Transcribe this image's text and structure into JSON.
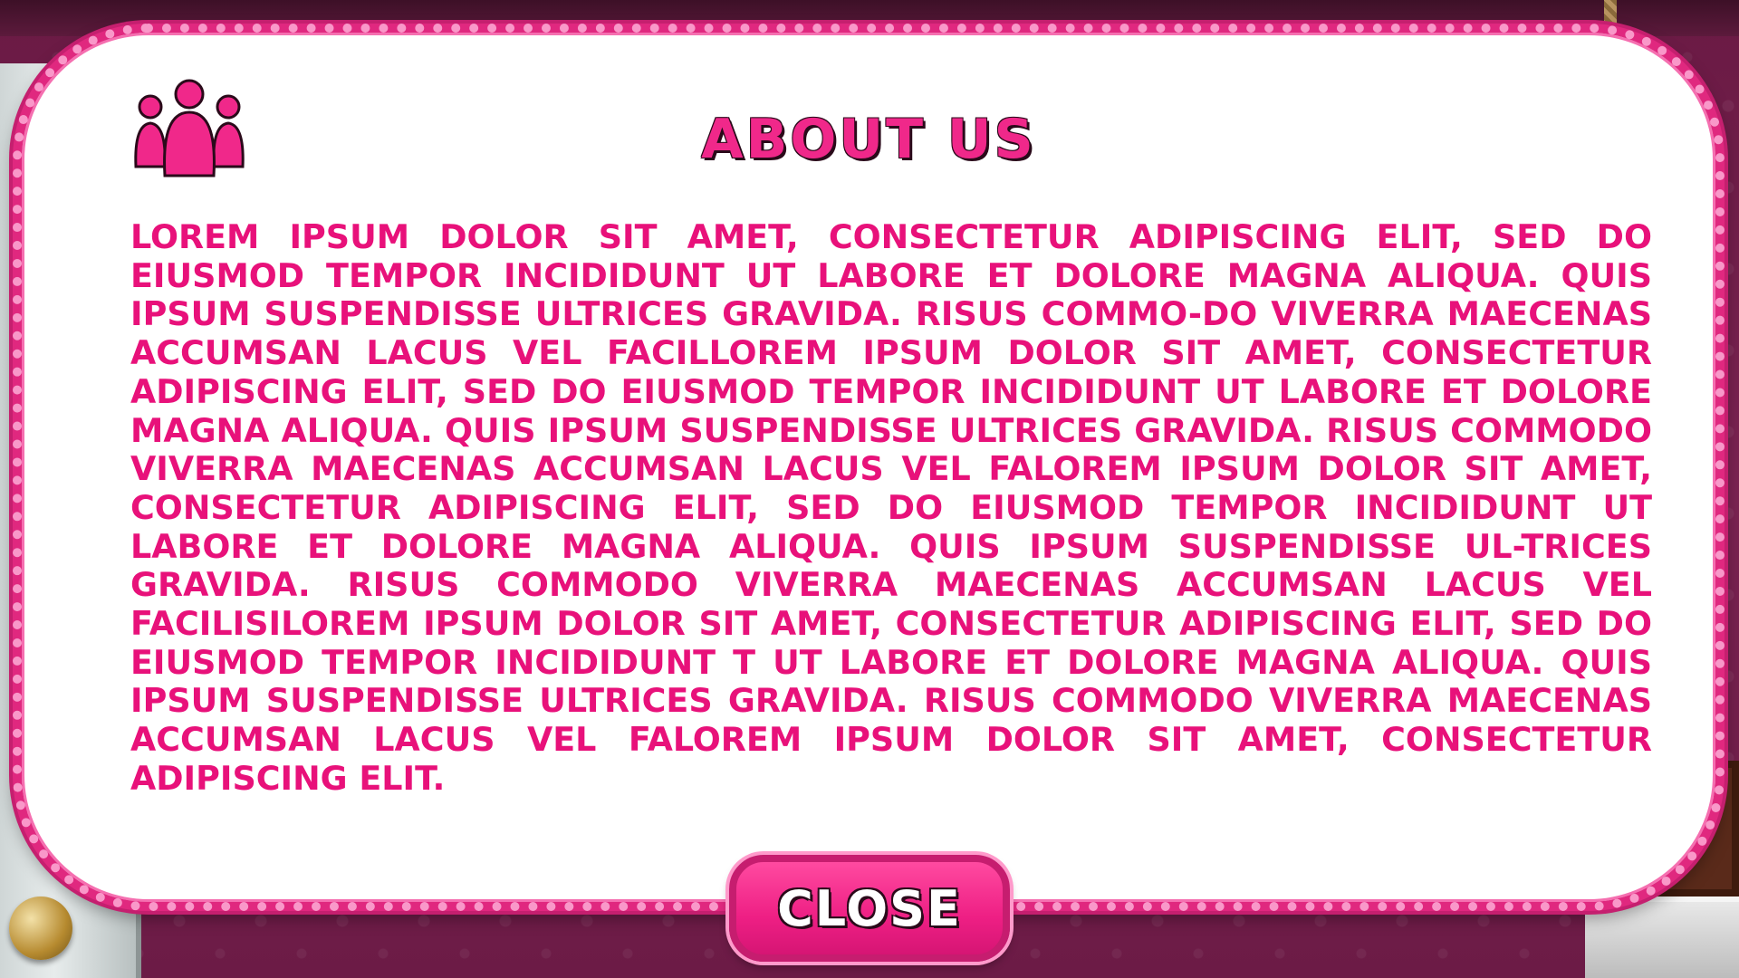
{
  "modal": {
    "title": "ABOUT US",
    "icon": "group-users-icon",
    "body": "LOREM IPSUM DOLOR SIT AMET, CONSECTETUR ADIPISCING ELIT, SED DO EIUSMOD TEMPOR INCIDIDUNT UT LABORE ET DOLORE MAGNA ALIQUA. QUIS IPSUM SUSPENDISSE ULTRICES GRAVIDA. RISUS COMMO-DO VIVERRA MAECENAS ACCUMSAN LACUS VEL FACILLOREM IPSUM DOLOR SIT AMET, CONSECTETUR ADIPISCING ELIT, SED DO EIUSMOD TEMPOR INCIDIDUNT UT LABORE ET DOLORE MAGNA ALIQUA. QUIS IPSUM SUSPENDISSE ULTRICES GRAVIDA. RISUS COMMODO VIVERRA MAECENAS ACCUMSAN LACUS VEL FALOREM IPSUM DOLOR SIT AMET, CONSECTETUR ADIPISCING ELIT, SED DO EIUSMOD TEMPOR INCIDIDUNT UT LABORE ET DOLORE MAGNA ALIQUA. QUIS IPSUM SUSPENDISSE UL-TRICES GRAVIDA. RISUS COMMODO VIVERRA MAECENAS ACCUMSAN LACUS VEL FACILISILOREM IPSUM DOLOR SIT AMET, CONSECTETUR ADIPISCING ELIT, SED DO EIUSMOD TEMPOR INCIDIDUNT T UT LABORE ET DOLORE MAGNA ALIQUA. QUIS IPSUM SUSPENDISSE ULTRICES GRAVIDA. RISUS COMMODO VIVERRA MAECENAS ACCUMSAN LACUS VEL FALOREM IPSUM DOLOR SIT AMET, CONSECTETUR ADIPISCING ELIT.",
    "close_label": "CLOSE"
  },
  "colors": {
    "accent_pink": "#e8117a",
    "border_pink": "#e0287f",
    "button_pink": "#ee1f84",
    "background_wall": "#7a2150"
  }
}
